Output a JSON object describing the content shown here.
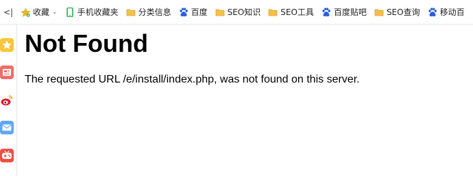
{
  "bookmarks_bar": {
    "collapse_label": "<|",
    "items": [
      {
        "label": "收藏",
        "icon": "star-icon",
        "has_dropdown": true
      },
      {
        "label": "手机收藏夹",
        "icon": "phone-icon"
      },
      {
        "label": "分类信息",
        "icon": "folder-icon"
      },
      {
        "label": "百度",
        "icon": "baidu-paw-icon"
      },
      {
        "label": "SEO知识",
        "icon": "folder-icon"
      },
      {
        "label": "SEO工具",
        "icon": "folder-icon"
      },
      {
        "label": "百度贴吧",
        "icon": "baidu-paw-icon"
      },
      {
        "label": "SEO查询",
        "icon": "folder-icon"
      },
      {
        "label": "移动百",
        "icon": "baidu-paw-icon"
      }
    ]
  },
  "sidebar": {
    "icons": [
      "favorites-star-icon",
      "news-icon",
      "weibo-icon",
      "mail-icon",
      "game-icon"
    ]
  },
  "page": {
    "title": "Not Found",
    "message": "The requested URL /e/install/index.php, was not found on this server."
  },
  "colors": {
    "folder": "#f5c04a",
    "baidu": "#2b5fd9",
    "star": "#f6b821",
    "phone": "#22b14c",
    "weibo": "#e6162d",
    "mail": "#5aa0f2",
    "news": "#f25f5c",
    "game": "#e8453c"
  }
}
